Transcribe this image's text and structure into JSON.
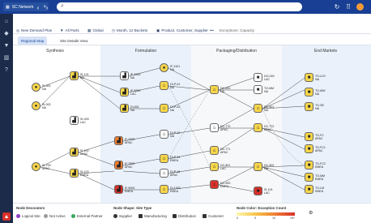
{
  "app": {
    "tab_title": "SC Network"
  },
  "search": {
    "placeholder": ""
  },
  "toolbar": {
    "new_demand_plan": "New Demand Plan",
    "all_parts": "All Parts",
    "global": "Global",
    "month_buckets": "Month, 12 Buckets",
    "product_filter": "Product, Customer, Supplier",
    "more": "•••",
    "exceptions": "Exceptions: Capacity"
  },
  "subtabs": [
    "Regional Map",
    "Site Details View"
  ],
  "columns": [
    "Synthesis",
    "Formulation",
    "Packaging/Distribution",
    "End Markets"
  ],
  "nodes": {
    "s1": {
      "id": "SI-001",
      "region": "NA"
    },
    "s2": {
      "id": "SI-002",
      "region": "NA"
    },
    "s3": {
      "id": "SI-009",
      "region": "LAC"
    },
    "s4": {
      "id": "SI-101",
      "region": "NA"
    },
    "s5": {
      "id": "SI-100",
      "region": "NA"
    },
    "s6": {
      "id": "SI-102",
      "region": "APAC"
    },
    "s7": {
      "id": "SI-103",
      "region": "EMEA"
    },
    "s8": {
      "id": "SI-700",
      "region": "APAC"
    },
    "f1": {
      "id": "IF-1000",
      "region": "NA"
    },
    "f2": {
      "id": "IF-3000",
      "region": "LAC"
    },
    "f3": {
      "id": "DI-501",
      "region": "NA"
    },
    "f4": {
      "id": "IF-1101",
      "region": "NA"
    },
    "f5": {
      "id": "DI-P-01",
      "region": "NA"
    },
    "f6": {
      "id": "DI-P-02",
      "region": "NA"
    },
    "f7": {
      "id": "DI-P-03",
      "region": "NA"
    },
    "f8": {
      "id": "IF-7000",
      "region": "APAC"
    },
    "f9": {
      "id": "DI-P-04",
      "region": "EMEA"
    },
    "f10": {
      "id": "IF-7500",
      "region": "APAC"
    },
    "f11": {
      "id": "DI-P-06",
      "region": "APAC"
    },
    "f12": {
      "id": "DI-P-07",
      "region": "APAC"
    },
    "f13": {
      "id": "IF-9000",
      "region": "EMEA"
    },
    "f14": {
      "id": "IF-1901",
      "region": "NA"
    },
    "f15": {
      "id": "DI-1002",
      "region": "EMEA"
    },
    "p1": {
      "id": "DC-500",
      "region": "NA"
    },
    "p2": {
      "id": "DC-501",
      "region": "NA"
    },
    "p3": {
      "id": "DC-502",
      "region": "NA"
    },
    "p4": {
      "id": "DC-503",
      "region": "NA"
    },
    "p5": {
      "id": "DC-770",
      "region": "APAC"
    },
    "p6": {
      "id": "DC-771",
      "region": "APAC"
    },
    "p7": {
      "id": "DC-772",
      "region": "APAC"
    },
    "p8": {
      "id": "DC-801",
      "region": "LAC"
    },
    "p9": {
      "id": "DC-900",
      "region": "EMEA"
    },
    "e1": {
      "id": "DO-020",
      "region": "LAC"
    },
    "e2": {
      "id": "DO-021",
      "region": "LAC"
    },
    "e3": {
      "id": "DO-022",
      "region": "LAC"
    },
    "e4": {
      "id": "TO-MM",
      "region": "NA"
    },
    "e5": {
      "id": "TO-PC",
      "region": "NA"
    },
    "m1": {
      "id": "TO-LDY",
      "region": "NA"
    },
    "m2": {
      "id": "TO-MW",
      "region": "NA"
    },
    "m3": {
      "id": "TO-SE",
      "region": "NA"
    },
    "m4": {
      "id": "TO-FC",
      "region": "APAC"
    },
    "m5": {
      "id": "TO-FC1",
      "region": "APAC"
    },
    "m6": {
      "id": "TO-FC2",
      "region": "EMEA"
    },
    "m7": {
      "id": "TO-MM",
      "region": "EMEA"
    },
    "m8": {
      "id": "TO-LM",
      "region": "EMEA"
    },
    "m9": {
      "id": "SI-101",
      "region": "LAC"
    }
  },
  "legend": {
    "decorators_title": "Node Decorators",
    "logical_site": "Logical Site",
    "not_active": "Not Active",
    "external_partner": "External Partner",
    "shape_title": "Node Shape: Site Type",
    "supplier": "Supplier",
    "manufacturing": "Manufacturing",
    "distribution": "Distribution",
    "customer": "Customer",
    "color_title": "Node Color: Exception Count",
    "ticks": [
      "0",
      "5",
      "10",
      "15+"
    ]
  }
}
